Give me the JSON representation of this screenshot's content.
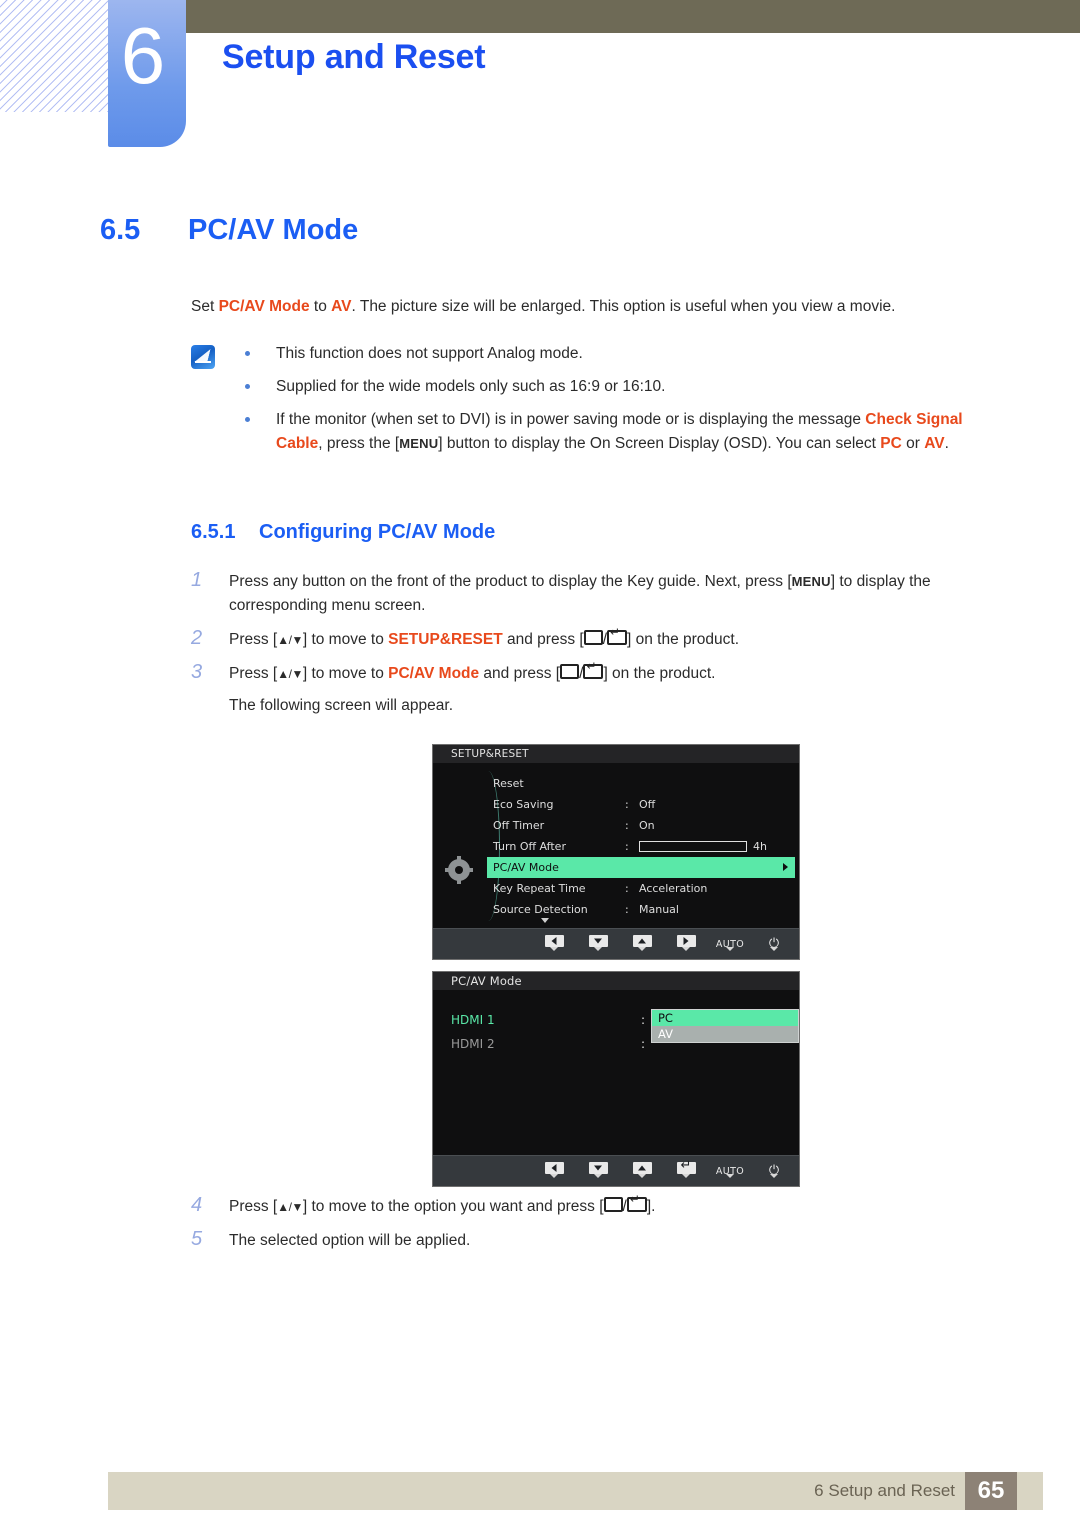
{
  "header": {
    "chapter_number": "6",
    "chapter_title": "Setup and Reset"
  },
  "section": {
    "number": "6.5",
    "title": "PC/AV Mode"
  },
  "intro": {
    "p1_a": "Set ",
    "p1_b": "PC/AV Mode",
    "p1_c": " to ",
    "p1_d": "AV",
    "p1_e": ". The picture size will be enlarged. This option is useful when you view a movie."
  },
  "notes": [
    {
      "text": "This function does not support Analog mode."
    },
    {
      "text": "Supplied for the wide models only such as 16:9 or 16:10."
    }
  ],
  "note3": {
    "a": "If the monitor (when set to DVI) is in power saving mode or is displaying the message ",
    "b": "Check Signal Cable",
    "c": ", press the [",
    "menu": "MENU",
    "d": "] button to display the On Screen Display (OSD). You can select ",
    "e": "PC",
    "f": " or ",
    "g": "AV",
    "h": "."
  },
  "subsection": {
    "number": "6.5.1",
    "title": "Configuring PC/AV Mode"
  },
  "steps": [
    {
      "n": "1",
      "a": "Press any button on the front of the product to display the Key guide. Next, press [",
      "menu": "MENU",
      "b": "] to display the corresponding menu screen."
    },
    {
      "n": "2",
      "a": "Press [",
      "arrows": "▲/▼",
      "b": "] to move to ",
      "target": "SETUP&RESET",
      "c": " and press [",
      "d": "/",
      "e": "] on the product."
    },
    {
      "n": "3",
      "a": "Press [",
      "arrows": "▲/▼",
      "b": "] to move to ",
      "target": "PC/AV Mode",
      "c": " and press [",
      "d": "/",
      "e": "] on the product.",
      "sub": "The following screen will appear."
    },
    {
      "n": "4",
      "a": "Press [",
      "arrows": "▲/▼",
      "b": "] to move to the option you want and press [",
      "d": "/",
      "e": "]."
    },
    {
      "n": "5",
      "a": "The selected option will be applied."
    }
  ],
  "osd1": {
    "title": "SETUP&RESET",
    "rows": [
      {
        "label": "Reset",
        "colon": "",
        "value": ""
      },
      {
        "label": "Eco Saving",
        "colon": ":",
        "value": "Off"
      },
      {
        "label": "Off Timer",
        "colon": ":",
        "value": "On"
      },
      {
        "label": "Turn Off After",
        "colon": ":",
        "value": "4h",
        "slider": true
      },
      {
        "label": "PC/AV Mode",
        "colon": "",
        "value": "",
        "selected": true
      },
      {
        "label": "Key Repeat Time",
        "colon": ":",
        "value": "Acceleration"
      },
      {
        "label": "Source Detection",
        "colon": ":",
        "value": "Manual"
      }
    ],
    "keys": [
      {
        "name": "left-arrow-key",
        "type": "icon",
        "glyph": "left",
        "label": ""
      },
      {
        "name": "down-arrow-key",
        "type": "icon",
        "glyph": "down",
        "label": ""
      },
      {
        "name": "up-arrow-key",
        "type": "icon",
        "glyph": "up",
        "label": ""
      },
      {
        "name": "right-arrow-key",
        "type": "icon",
        "glyph": "right",
        "label": ""
      },
      {
        "name": "auto-key",
        "type": "text",
        "glyph": "",
        "label": "AUTO"
      },
      {
        "name": "power-key",
        "type": "power",
        "glyph": "",
        "label": "⏻"
      }
    ]
  },
  "osd2": {
    "title": "PC/AV Mode",
    "rows": [
      {
        "label": "HDMI 1",
        "colon": ":",
        "highlight": true
      },
      {
        "label": "HDMI 2",
        "colon": ":",
        "highlight": false
      }
    ],
    "dropdown": [
      {
        "label": "PC",
        "selected": true
      },
      {
        "label": "AV",
        "selected": false
      }
    ],
    "keys": [
      {
        "name": "left-arrow-key",
        "type": "icon",
        "glyph": "left",
        "label": ""
      },
      {
        "name": "down-arrow-key",
        "type": "icon",
        "glyph": "down",
        "label": ""
      },
      {
        "name": "up-arrow-key",
        "type": "icon",
        "glyph": "up",
        "label": ""
      },
      {
        "name": "enter-key",
        "type": "enter",
        "glyph": "",
        "label": ""
      },
      {
        "name": "auto-key",
        "type": "text",
        "glyph": "",
        "label": "AUTO"
      },
      {
        "name": "power-key",
        "type": "power",
        "glyph": "",
        "label": "⏻"
      }
    ]
  },
  "footer": {
    "text": "6 Setup and Reset",
    "page": "65"
  },
  "colors": {
    "accent_blue": "#1b5ef4",
    "highlight_red": "#e8491c",
    "osd_green": "#5ae8a8",
    "brown_bar": "#6e6a56",
    "footer_bar": "#d9d5c3",
    "footer_page": "#8d8276"
  }
}
